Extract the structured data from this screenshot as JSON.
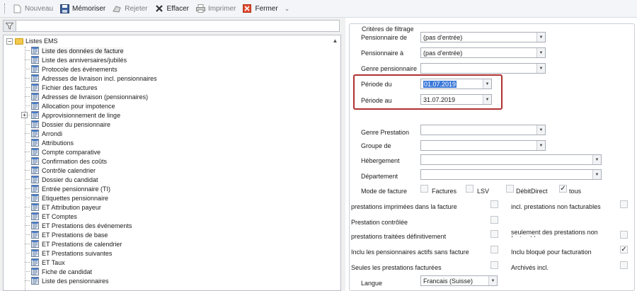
{
  "toolbar": {
    "nouveau": "Nouveau",
    "memoriser": "Mémoriser",
    "rejeter": "Rejeter",
    "effacer": "Effacer",
    "imprimer": "Imprimer",
    "fermer": "Fermer",
    "more": "⌄"
  },
  "filter": {
    "value": ""
  },
  "tree": {
    "root_label": "Listes EMS",
    "items": [
      "Liste des données de facture",
      "Liste des anniversaires/jubilés",
      "Protocole des événements",
      "Adresses de livraison incl. pensionnaires",
      "Fichier des factures",
      "Adresses de livraison (pensionnaires)",
      "Allocation pour impotence",
      "Approvisionnement de linge",
      "Dossier du pensionnaire",
      "Arrondi",
      "Attributions",
      "Compte comparative",
      "Confirmation des coûts",
      "Contrôle calendrier",
      "Dossier du candidat",
      "Entrée pensionnaire (TI)",
      "Etiquettes pensionnaire",
      "ET Attribution payeur",
      "ET Comptes",
      "ET Prestations des événements",
      "ET Prestations de base",
      "ET Prestations de calendrier",
      "ET Prestations suivantes",
      "ET Taux",
      "Fiche de candidat",
      "Liste des pensionnaires"
    ]
  },
  "criteria": {
    "title": "Critères de filtrage",
    "pensionnaire_de": {
      "label": "Pensionnaire de",
      "value": "(pas d'entrée)"
    },
    "pensionnaire_a": {
      "label": "Pensionnaire à",
      "value": "(pas d'entrée)"
    },
    "genre_pensionnaire": {
      "label": "Genre pensionnaire",
      "value": ""
    },
    "periode_du": {
      "label": "Période du",
      "value": "01.07.2019"
    },
    "periode_au": {
      "label": "Période au",
      "value": "31.07.2019"
    },
    "genre_prestation": {
      "label": "Genre Prestation",
      "value": ""
    },
    "groupe_de": {
      "label": "Groupe de",
      "value": ""
    },
    "hebergement": {
      "label": "Hébergement",
      "value": ""
    },
    "departement": {
      "label": "Département",
      "value": ""
    },
    "mode_facture": {
      "label": "Mode de facture",
      "options": [
        {
          "label": "Factures",
          "checked": false
        },
        {
          "label": "LSV",
          "checked": false
        },
        {
          "label": "DébitDirect",
          "checked": false
        },
        {
          "label": "tous",
          "checked": true
        }
      ]
    },
    "checks_left": [
      {
        "label": "prestations imprimées dans la facture",
        "checked": false
      },
      {
        "label": "Prestation contrôlée",
        "checked": false
      },
      {
        "label": "prestations traitées définitivement",
        "checked": false
      },
      {
        "label": "Inclu les pensionnaires actifs sans facture",
        "checked": false
      },
      {
        "label": "Seules les prestations facturées",
        "checked": false
      }
    ],
    "checks_right": [
      {
        "label": "incl. prestations non facturables",
        "checked": false
      },
      {
        "label": "seulement des prestations non facturables",
        "checked": false
      },
      {
        "label": "Inclu bloqué pour facturation",
        "checked": true
      },
      {
        "label": "Archivés incl.",
        "checked": false
      }
    ],
    "langue": {
      "label": "Langue",
      "value": "Francais (Suisse)"
    }
  },
  "colors": {
    "highlight": "#b03030",
    "selection": "#3b78d8"
  }
}
